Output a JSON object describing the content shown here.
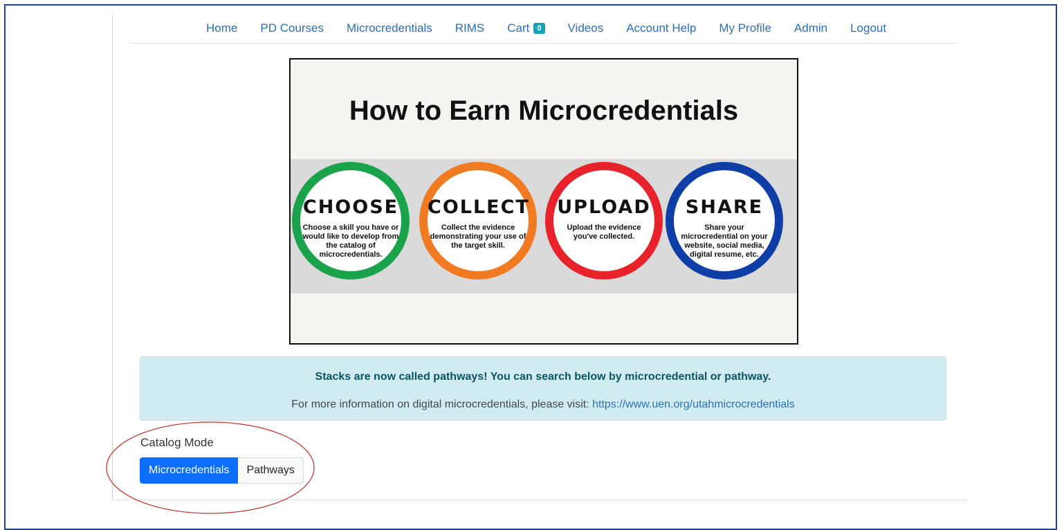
{
  "nav": {
    "items": [
      {
        "label": "Home"
      },
      {
        "label": "PD Courses"
      },
      {
        "label": "Microcredentials"
      },
      {
        "label": "RIMS"
      },
      {
        "label": "Cart"
      },
      {
        "label": "Videos"
      },
      {
        "label": "Account Help"
      },
      {
        "label": "My Profile"
      },
      {
        "label": "Admin"
      },
      {
        "label": "Logout"
      }
    ],
    "cart_count": "0"
  },
  "infographic": {
    "title": "How to Earn Microcredentials",
    "steps": [
      {
        "title": "CHOOSE",
        "desc": "Choose a skill you have or would like to develop from the catalog of microcredentials.",
        "color": "#1aa34a"
      },
      {
        "title": "COLLECT",
        "desc": "Collect the evidence demonstrating your use of the target skill.",
        "color": "#f07b22"
      },
      {
        "title": "UPLOAD",
        "desc": "Upload the evidence you've collected.",
        "color": "#e8222a"
      },
      {
        "title": "SHARE",
        "desc": "Share your microcredential on your website, social media, digital resume, etc.",
        "color": "#0f3fa6"
      }
    ]
  },
  "alert": {
    "heading": "Stacks are now called pathways! You can search below by microcredential or pathway.",
    "info_text": "For more information on digital microcredentials, please visit: ",
    "link_text": "https://www.uen.org/utahmicrocredentials"
  },
  "catalog": {
    "label": "Catalog Mode",
    "options": [
      {
        "label": "Microcredentials",
        "active": true
      },
      {
        "label": "Pathways",
        "active": false
      }
    ]
  },
  "colors": {
    "accent": "#0d6efd",
    "link": "#2a6fb5",
    "alert_bg": "#d1ecf1",
    "annotation": "#c0392b"
  }
}
